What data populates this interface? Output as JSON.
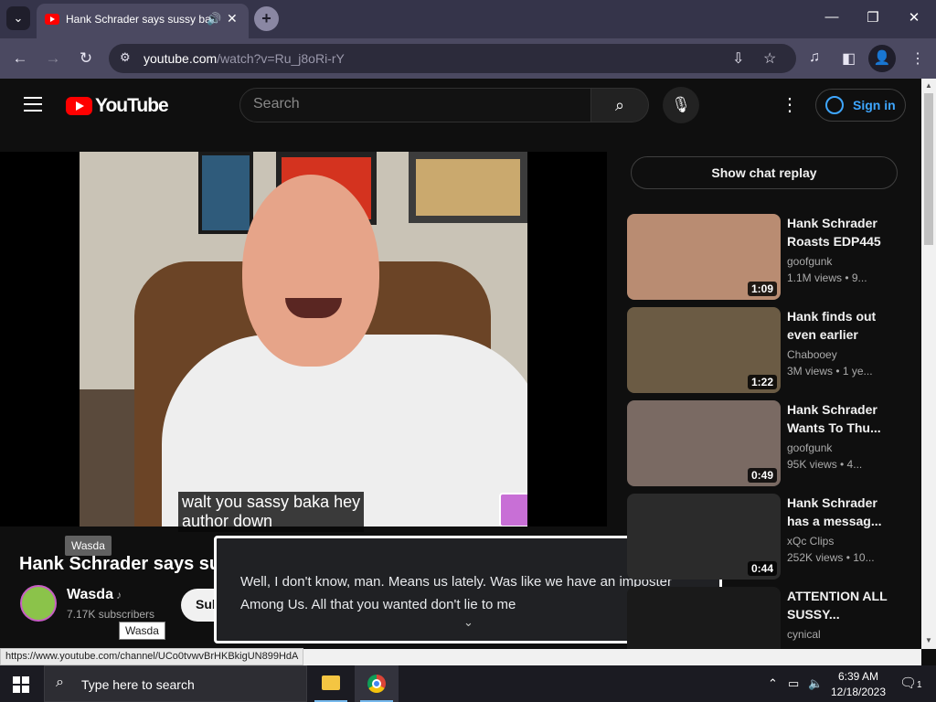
{
  "browser": {
    "tab_title": "Hank Schrader says sussy baka",
    "url_host": "youtube.com",
    "url_path": "/watch?v=Ru_j8oRi-rY"
  },
  "youtube": {
    "logo_text": "YouTube",
    "search_placeholder": "Search",
    "sign_in_label": "Sign in"
  },
  "video": {
    "caption_line1": "walt you sassy baka hey",
    "caption_line2": "author down",
    "title": "Hank Schrader says sus",
    "channel_name": "Wasda",
    "subscribers": "7.17K subscribers",
    "subscribe_label": "Sub",
    "tooltip_channel": "Wasda",
    "tooltip_cursor": "Wasda"
  },
  "transcript_popup": {
    "text": "Well, I don't know, man. Means us lately. Was like we have an imposter Among Us. All that you wanted don't lie to me"
  },
  "sidebar": {
    "chat_replay_label": "Show chat replay",
    "recommendations": [
      {
        "title": "Hank Schrader Roasts EDP445",
        "channel": "goofgunk",
        "meta": "1.1M views • 9...",
        "duration": "1:09",
        "thumb_color": "#b98c72"
      },
      {
        "title": "Hank finds out even earlier",
        "channel": "Chabooey",
        "meta": "3M views • 1 ye...",
        "duration": "1:22",
        "thumb_color": "#6b5b44"
      },
      {
        "title": "Hank Schrader Wants To Thu...",
        "channel": "goofgunk",
        "meta": "95K views • 4...",
        "duration": "0:49",
        "thumb_color": "#7a6a63"
      },
      {
        "title": "Hank Schrader has a messag...",
        "channel": "xQc Clips",
        "meta": "252K views • 10...",
        "duration": "0:44",
        "thumb_color": "#2b2b2b"
      },
      {
        "title": "ATTENTION ALL SUSSY...",
        "channel": "cynical",
        "meta": "",
        "duration": "",
        "thumb_color": "#1a1a1a"
      }
    ]
  },
  "status_bar": {
    "url": "https://www.youtube.com/channel/UCo0tvwvBrHKBkigUN899HdA"
  },
  "taskbar": {
    "search_placeholder": "Type here to search",
    "time": "6:39 AM",
    "date": "12/18/2023",
    "notification_count": "1"
  }
}
